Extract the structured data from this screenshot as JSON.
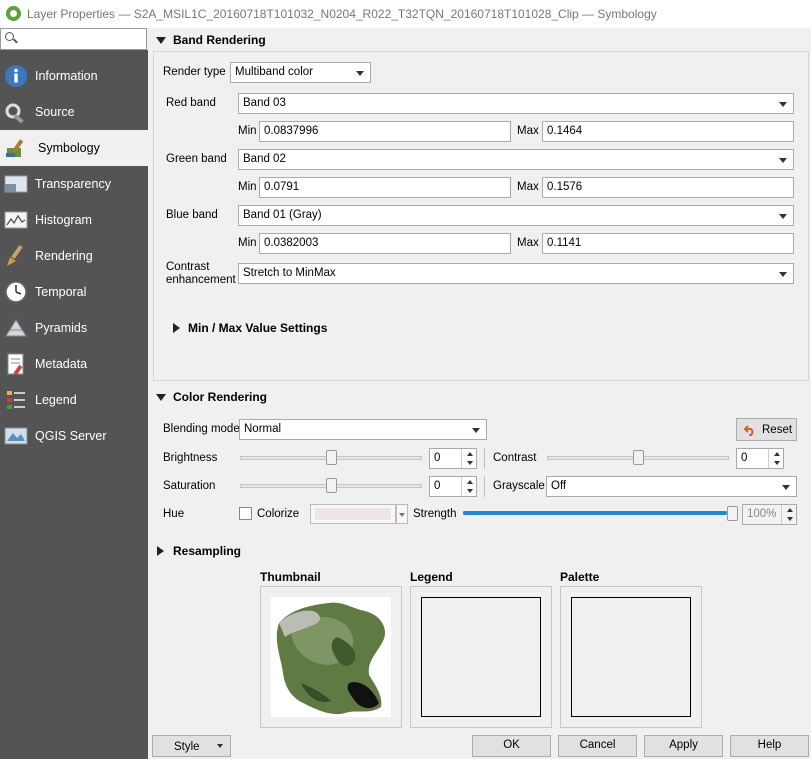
{
  "window": {
    "title": "Layer Properties — S2A_MSIL1C_20160718T101032_N0204_R022_T32TQN_20160718T101028_Clip — Symbology"
  },
  "search": {
    "placeholder": ""
  },
  "sidebar": {
    "items": [
      {
        "label": "Information",
        "icon": "info-icon"
      },
      {
        "label": "Source",
        "icon": "source-icon"
      },
      {
        "label": "Symbology",
        "icon": "symbology-icon"
      },
      {
        "label": "Transparency",
        "icon": "transparency-icon"
      },
      {
        "label": "Histogram",
        "icon": "histogram-icon"
      },
      {
        "label": "Rendering",
        "icon": "rendering-icon"
      },
      {
        "label": "Temporal",
        "icon": "temporal-icon"
      },
      {
        "label": "Pyramids",
        "icon": "pyramids-icon"
      },
      {
        "label": "Metadata",
        "icon": "metadata-icon"
      },
      {
        "label": "Legend",
        "icon": "legend-icon"
      },
      {
        "label": "QGIS Server",
        "icon": "qgis-server-icon"
      }
    ],
    "active": "Symbology"
  },
  "band_rendering": {
    "header": "Band Rendering",
    "render_type_label": "Render type",
    "render_type": "Multiband color",
    "red_label": "Red band",
    "red_band": "Band 03",
    "red_min": "0.0837996",
    "red_max": "0.1464",
    "green_label": "Green band",
    "green_band": "Band 02",
    "green_min": "0.0791",
    "green_max": "0.1576",
    "blue_label": "Blue band",
    "blue_band": "Band 01 (Gray)",
    "blue_min": "0.0382003",
    "blue_max": "0.1141",
    "min_label": "Min",
    "max_label": "Max",
    "contrast_label_1": "Contrast",
    "contrast_label_2": "enhancement",
    "contrast": "Stretch to MinMax",
    "minmax_settings": "Min / Max Value Settings"
  },
  "color_rendering": {
    "header": "Color Rendering",
    "blending_label": "Blending mode",
    "blending": "Normal",
    "reset": "Reset",
    "brightness_label": "Brightness",
    "brightness": "0",
    "contrast_label": "Contrast",
    "contrast": "0",
    "saturation_label": "Saturation",
    "saturation": "0",
    "grayscale_label": "Grayscale",
    "grayscale": "Off",
    "hue_label": "Hue",
    "colorize_label": "Colorize",
    "strength_label": "Strength",
    "strength": "100%",
    "brightness_level": 0.5,
    "contrast_level": 0.5,
    "saturation_level": 0.5,
    "strength_level": 1.0
  },
  "resampling": {
    "header": "Resampling"
  },
  "previews": {
    "thumbnail_label": "Thumbnail",
    "legend_label": "Legend",
    "palette_label": "Palette"
  },
  "buttons": {
    "style": "Style",
    "ok": "OK",
    "cancel": "Cancel",
    "apply": "Apply",
    "help": "Help"
  },
  "colors": {
    "sidebar_bg": "#545454",
    "strength_bar": "#1e88d6",
    "qgis_green": "#5aa33a"
  }
}
